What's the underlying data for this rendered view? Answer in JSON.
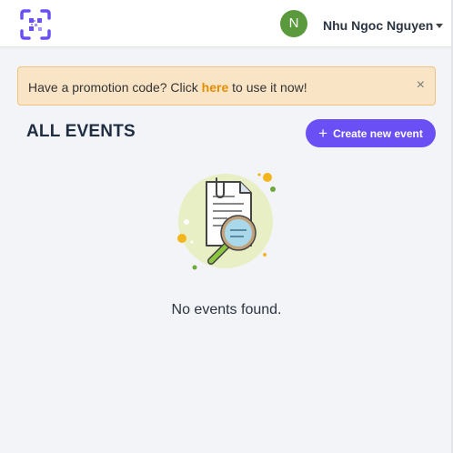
{
  "user": {
    "avatar_initial": "N",
    "name": "Nhu Ngoc Nguyen"
  },
  "promo": {
    "text_before": "Have a promotion code? Click ",
    "link": "here",
    "text_after": " to use it now!",
    "close": "×"
  },
  "events": {
    "heading": "ALL EVENTS",
    "create_label": "Create new event",
    "empty_message": "No events found."
  },
  "colors": {
    "accent": "#6a4ff5",
    "avatar": "#5b9a3c",
    "promo_bg": "#fae4c6",
    "promo_link": "#e38e00"
  },
  "icons": {
    "logo": "qr-code-logo-icon",
    "caret": "caret-down-icon",
    "close": "close-icon",
    "plus": "plus-icon",
    "illustration": "document-search-illustration"
  }
}
